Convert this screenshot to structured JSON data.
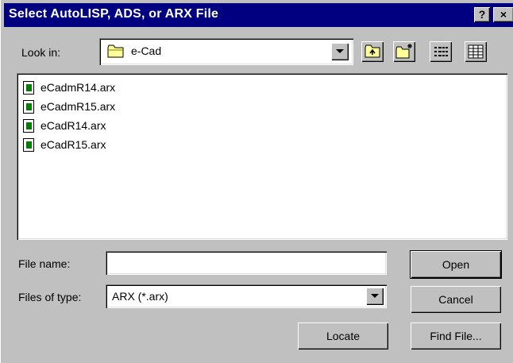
{
  "window": {
    "title": "Select AutoLISP, ADS, or ARX File",
    "help_label": "?",
    "close_label": "×"
  },
  "look_in": {
    "label": "Look in:",
    "value": "e-Cad"
  },
  "toolbar": {
    "icons": [
      "up-one-level-icon",
      "create-new-folder-icon",
      "list-view-icon",
      "details-view-icon"
    ]
  },
  "files": [
    {
      "name": "eCadmR14.arx",
      "icon": "arx-file-icon"
    },
    {
      "name": "eCadmR15.arx",
      "icon": "arx-file-icon"
    },
    {
      "name": "eCadR14.arx",
      "icon": "arx-file-icon"
    },
    {
      "name": "eCadR15.arx",
      "icon": "arx-file-icon"
    }
  ],
  "file_name": {
    "label": "File name:",
    "value": ""
  },
  "file_type": {
    "label": "Files of type:",
    "value": "ARX (*.arx)"
  },
  "buttons": {
    "open": "Open",
    "cancel": "Cancel",
    "locate": "Locate",
    "find_file": "Find File..."
  },
  "colors": {
    "titlebar": "#000080",
    "dialog_face": "#c0c0c0",
    "file_icon_accent": "#008000"
  }
}
